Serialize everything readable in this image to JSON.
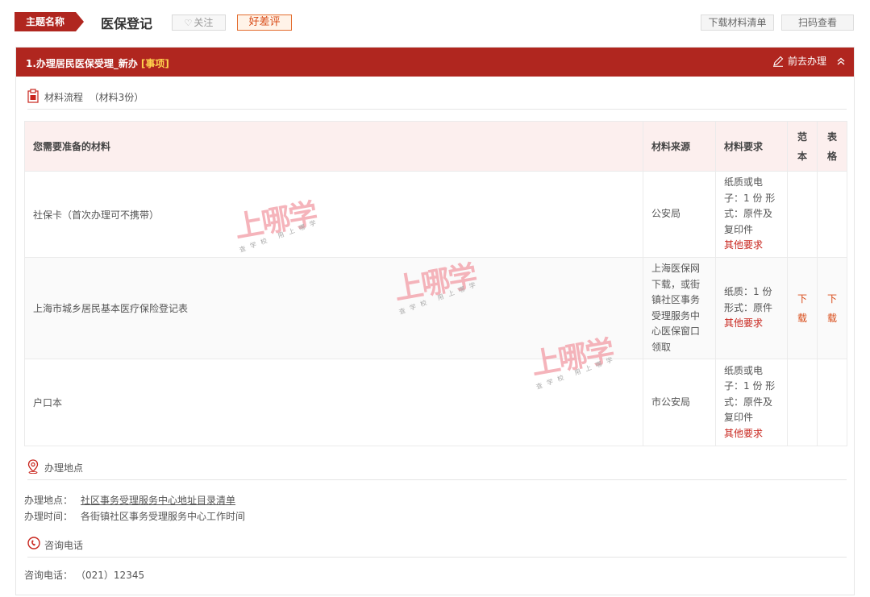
{
  "header": {
    "theme_tag": "主题名称",
    "title": "医保登记",
    "follow_label": "关注",
    "review_label": "好差评",
    "download_list_label": "下载材料清单",
    "scan_label": "扫码查看"
  },
  "panel": {
    "title": "1.办理居民医保受理_新办",
    "tag": "[事项]",
    "go_label": "前去办理"
  },
  "materials": {
    "section_title": "材料流程",
    "count_label": "（材料3份）",
    "columns": [
      "您需要准备的材料",
      "材料来源",
      "材料要求",
      "范本",
      "表格"
    ],
    "rows": [
      {
        "name": "社保卡（首次办理可不携带）",
        "source": "公安局",
        "requirement": "纸质或电子：1 份 形式：原件及复印件",
        "other": "其他要求",
        "sample": "",
        "form": ""
      },
      {
        "name": "上海市城乡居民基本医疗保险登记表",
        "source": "上海医保网下载，或街镇社区事务受理服务中心医保窗口领取",
        "requirement": "纸质：1 份 形式：原件",
        "other": "其他要求",
        "sample": "下载",
        "form": "下载"
      },
      {
        "name": "户口本",
        "source": "市公安局",
        "requirement": "纸质或电子：1 份 形式：原件及复印件",
        "other": "其他要求",
        "sample": "",
        "form": ""
      }
    ]
  },
  "location": {
    "section_title": "办理地点",
    "address_label": "办理地点：",
    "address_link": "社区事务受理服务中心地址目录清单",
    "time_label": "办理时间：",
    "time_value": "各街镇社区事务受理服务中心工作时间"
  },
  "contact": {
    "section_title": "咨询电话",
    "phone_label": "咨询电话：",
    "phone_value": "（021）12345"
  },
  "watermark": {
    "main": "上哪学",
    "sub": "查学校 用上哪学"
  },
  "colors": {
    "brand_red": "#b0261f",
    "accent_orange": "#d84a16",
    "header_row_bg": "#fcefee"
  }
}
